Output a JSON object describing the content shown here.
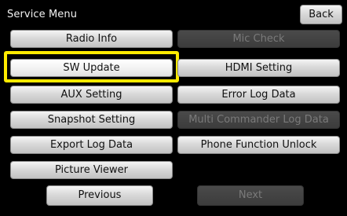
{
  "header": {
    "title": "Service Menu",
    "back_label": "Back"
  },
  "menu": {
    "radio_info": "Radio Info",
    "mic_check": "Mic Check",
    "sw_update": "SW Update",
    "hdmi_setting": "HDMI Setting",
    "aux_setting": "AUX Setting",
    "error_log_data": "Error Log Data",
    "snapshot_setting": "Snapshot Setting",
    "multi_commander_log_data": "Multi Commander Log Data",
    "export_log_data": "Export Log Data",
    "phone_function_unlock": "Phone Function Unlock",
    "picture_viewer": "Picture Viewer"
  },
  "pager": {
    "previous_label": "Previous",
    "next_label": "Next"
  },
  "colors": {
    "highlight": "#ffea00",
    "background": "#000000"
  },
  "state": {
    "selected_item": "SW Update",
    "disabled_items": [
      "Mic Check",
      "Multi Commander Log Data",
      "Next"
    ]
  }
}
